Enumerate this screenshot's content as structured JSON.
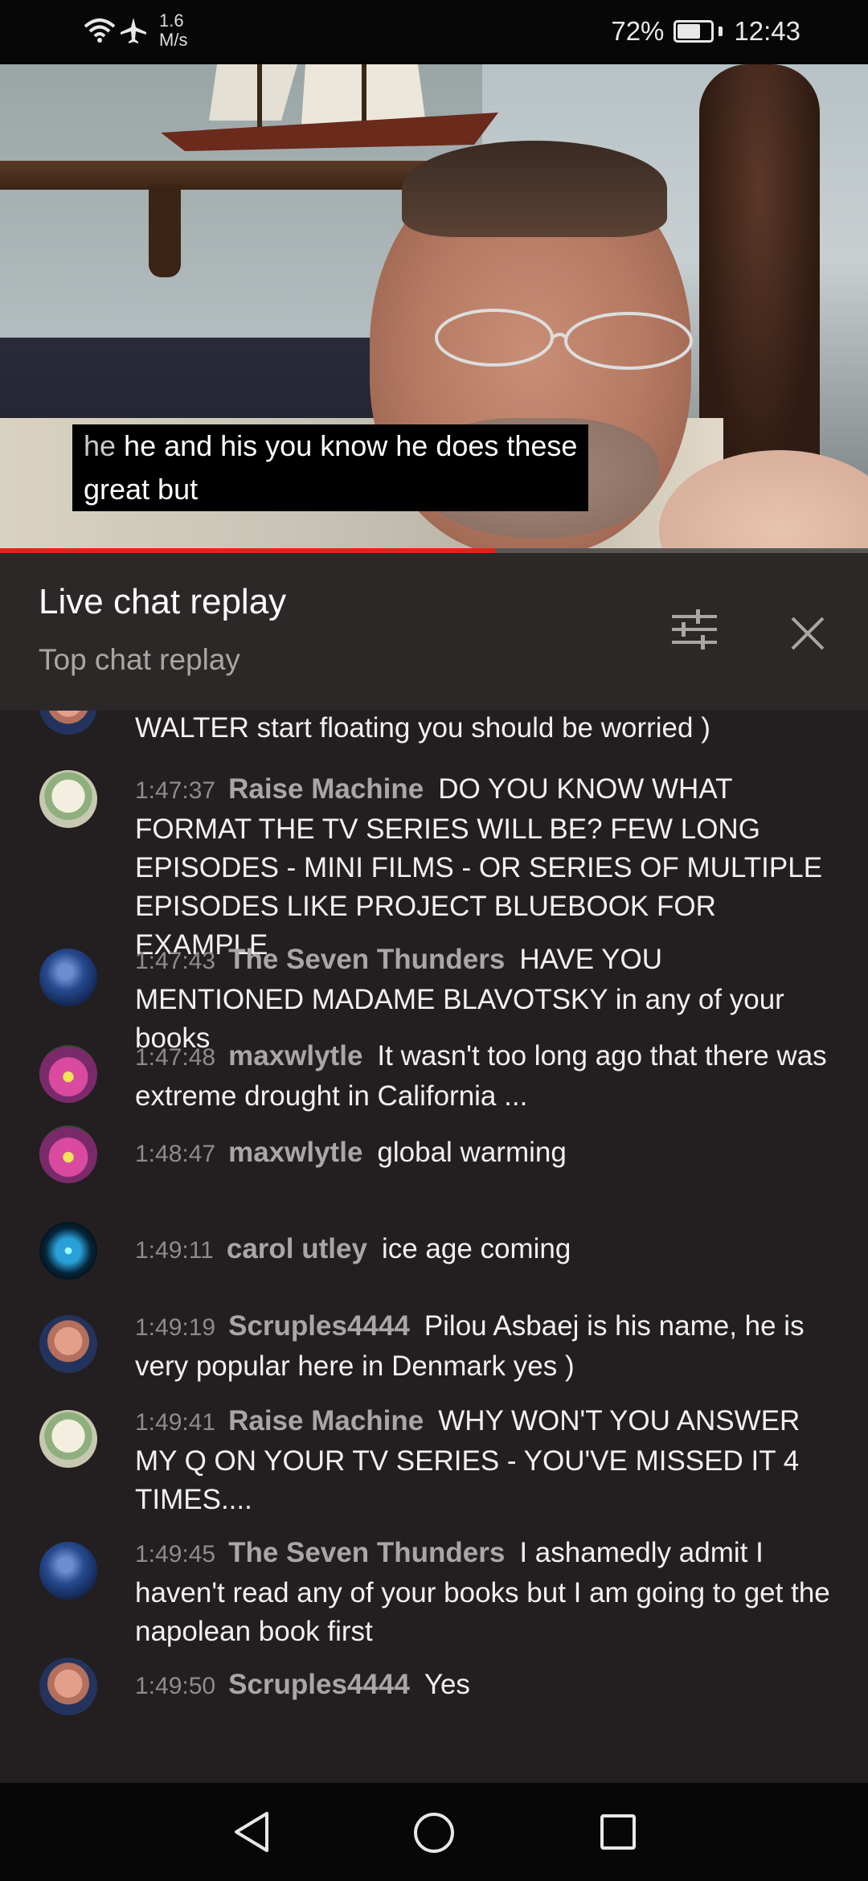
{
  "status_bar": {
    "network_speed": "1.6",
    "network_speed_unit": "M/s",
    "battery_percent": "72%",
    "battery_level": 0.72,
    "time": "12:43"
  },
  "video": {
    "caption_lines": [
      {
        "dim": "he",
        "text": " he and his you know he does these"
      },
      {
        "dim": "",
        "text": "great but"
      }
    ],
    "progress": 0.57
  },
  "chat_header": {
    "title": "Live chat replay",
    "subtitle": "Top chat replay"
  },
  "messages": [
    {
      "time": "",
      "author": "",
      "text": "WALTER start floating you should be worried )",
      "avatar": "scruples"
    },
    {
      "time": "1:47:37",
      "author": "Raise Machine",
      "text": "DO YOU KNOW WHAT FORMAT THE TV SERIES WILL BE? FEW LONG EPISODES - MINI FILMS - OR SERIES OF MULTIPLE EPISODES LIKE PROJECT BLUEBOOK FOR EXAMPLE",
      "avatar": "raise"
    },
    {
      "time": "1:47:43",
      "author": "The Seven Thunders",
      "text": "HAVE YOU MENTIONED MADAME BLAVOTSKY in any of your books",
      "avatar": "thunder"
    },
    {
      "time": "1:47:48",
      "author": "maxwlytle",
      "text": "It wasn't too long ago that there was extreme drought in California ...",
      "avatar": "maxw"
    },
    {
      "time": "1:48:47",
      "author": "maxwlytle",
      "text": "global warming",
      "avatar": "maxw"
    },
    {
      "time": "1:49:11",
      "author": "carol utley",
      "text": "ice age coming",
      "avatar": "carol"
    },
    {
      "time": "1:49:19",
      "author": "Scruples4444",
      "text": "Pilou Asbaej is his name, he is very popular here in Denmark yes )",
      "avatar": "scruples"
    },
    {
      "time": "1:49:41",
      "author": "Raise Machine",
      "text": "WHY WON'T YOU ANSWER MY Q ON YOUR TV SERIES - YOU'VE MISSED IT 4 TIMES....",
      "avatar": "raise"
    },
    {
      "time": "1:49:45",
      "author": "The Seven Thunders",
      "text": "I ashamedly admit I haven't read any of your books but I am going to get the napolean book first",
      "avatar": "thunder"
    },
    {
      "time": "1:49:50",
      "author": "Scruples4444",
      "text": "Yes",
      "avatar": "scruples"
    }
  ],
  "icons": {
    "wifi": "wifi-icon",
    "airplane": "airplane-icon",
    "battery": "battery-icon",
    "filter": "tune-icon",
    "close": "close-icon",
    "nav_back": "triangle-back-icon",
    "nav_home": "circle-home-icon",
    "nav_recent": "square-recent-icon"
  },
  "colors": {
    "progress": "#e62117",
    "chat_background": "#231f20",
    "header_background": "#2c2828"
  }
}
